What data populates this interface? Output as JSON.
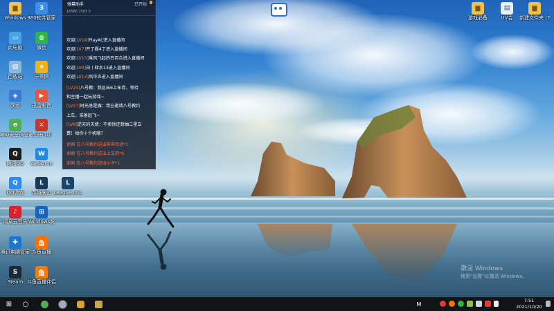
{
  "desktop_icons_left": [
    {
      "label": "Windows",
      "name": "folder-icon",
      "color": "#f2c14e",
      "glyph": "▆"
    },
    {
      "label": "360软件管家",
      "name": "360-icon",
      "color": "#3a8ee6",
      "glyph": "3"
    },
    {
      "label": "此电脑",
      "name": "computer-icon",
      "color": "#4aa3e6",
      "glyph": "▭"
    },
    {
      "label": "微信",
      "name": "wechat-icon",
      "color": "#2fb34a",
      "glyph": "◍"
    },
    {
      "label": "回收站",
      "name": "recycle-bin-icon",
      "color": "#8fb8d8",
      "glyph": "▤"
    },
    {
      "label": "宁哥网",
      "name": "app-icon",
      "color": "#f0b21a",
      "glyph": "★"
    },
    {
      "label": "网络",
      "name": "network-icon",
      "color": "#3a7bd5",
      "glyph": "◈"
    },
    {
      "label": "迅雷影音",
      "name": "video-player-icon",
      "color": "#e8533a",
      "glyph": "▶"
    },
    {
      "label": "360安全浏览器",
      "name": "browser-icon",
      "color": "#4caf50",
      "glyph": "e"
    },
    {
      "label": "荒野行动",
      "name": "game-icon",
      "color": "#c0392b",
      "glyph": "⚔"
    },
    {
      "label": "腾讯QQ",
      "name": "qq-icon",
      "color": "#1c1c1c",
      "glyph": "Q"
    },
    {
      "label": "WeGame",
      "name": "wegame-icon",
      "color": "#1e88e5",
      "glyph": "W"
    },
    {
      "label": "QQ游戏",
      "name": "qq-game-icon",
      "color": "#2d89ef",
      "glyph": "Q"
    },
    {
      "label": "英雄联盟",
      "name": "lol-icon",
      "color": "#1a3a5c",
      "glyph": "L"
    },
    {
      "label": "League of L",
      "name": "league-icon",
      "color": "#17486b",
      "glyph": "L"
    },
    {
      "label": "网易云音乐",
      "name": "music-icon",
      "color": "#d8232a",
      "glyph": "♪"
    },
    {
      "label": "Windows照",
      "name": "windows-app-icon",
      "color": "#1565c0",
      "glyph": "⊞"
    },
    {
      "label": "腾讯电脑管家",
      "name": "pc-manager-icon",
      "color": "#1976d2",
      "glyph": "✚"
    },
    {
      "label": "斗鱼直播",
      "name": "douyu-icon",
      "color": "#ff6f00",
      "glyph": "鱼"
    },
    {
      "label": "Steam",
      "name": "steam-icon",
      "color": "#1b2838",
      "glyph": "S"
    },
    {
      "label": "斗鱼直播伴侣",
      "name": "douyu-companion-icon",
      "color": "#ff7a00",
      "glyph": "鱼"
    }
  ],
  "desktop_icons_right": [
    {
      "label": "游戏必备",
      "name": "folder-games-icon",
      "color": "#f2c14e",
      "glyph": "▆"
    },
    {
      "label": "UV合",
      "name": "document-icon",
      "color": "#e8eef5",
      "glyph": "▤"
    },
    {
      "label": "新建文件夹 (7)",
      "name": "new-folder-icon",
      "color": "#f2c14e",
      "glyph": "▆"
    }
  ],
  "top_center_icon": {
    "name": "bilibili-app-icon"
  },
  "chat": {
    "room_title": "弹幕助手",
    "status": "已开始",
    "stats": "16586    1563    0",
    "entries": [
      {
        "prefix": "欢迎",
        "lv": "[LV18]",
        "text": "PlayAC进入直播间",
        "style": "lv"
      },
      {
        "prefix": "欢迎",
        "lv": "[LV7]",
        "text": "开了霸4丁进入直播间",
        "style": "lv"
      },
      {
        "prefix": "欢迎",
        "lv": "[LV15]",
        "text": "乘风飞起的白百合进入直播间",
        "style": "lv"
      },
      {
        "prefix": "欢迎",
        "lv": "[LV9]",
        "text": "白丨释水13进入直播间",
        "style": "lv"
      },
      {
        "prefix": "欢迎",
        "lv": "[LV14]",
        "text": "风华炎进入直播间",
        "style": "lv"
      },
      {
        "prefix": "",
        "lv": "[LV24]",
        "text": "八号教：我这出6上车券，等待",
        "style": "lv2"
      },
      {
        "prefix": "",
        "lv": "",
        "text": "和主播一起玩游戏~",
        "style": "none"
      },
      {
        "prefix": "",
        "lv": "[LV27]",
        "text": "时光总是痛：我已邀请八号教约",
        "style": "lv2"
      },
      {
        "prefix": "",
        "lv": "",
        "text": "上车，准备起飞~",
        "style": "none"
      },
      {
        "prefix": "",
        "lv": "[LV8]",
        "text": "逆天的天使：不卖惊还想抽三星五",
        "style": "lv2"
      },
      {
        "prefix": "",
        "lv": "",
        "text": "费！给你十个机哦？",
        "style": "none"
      },
      {
        "prefix": "",
        "lv": "",
        "text": "谢谢 在八号教约送出奔奔幸运*1",
        "style": "gift"
      },
      {
        "prefix": "",
        "lv": "",
        "text": "谢谢 在八号教约送出上车券*6",
        "style": "gift"
      },
      {
        "prefix": "",
        "lv": "",
        "text": "谢谢 在八号教约送出小卡*1",
        "style": "gift"
      }
    ]
  },
  "watermark": {
    "line1": "激活 Windows",
    "line2": "转到\"设置\"以激活 Windows。"
  },
  "taskbar": {
    "start_label": "⊞",
    "search_label": "○",
    "ime_label": "M",
    "time": "7:51",
    "date": "2021/10/20"
  },
  "colors": {
    "accent": "#f2c14e",
    "taskbar": "#121418",
    "chat_bg": "#141923"
  }
}
